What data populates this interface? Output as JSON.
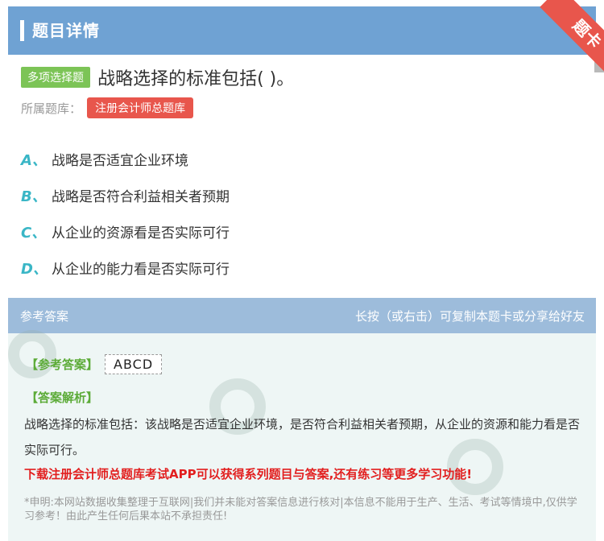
{
  "header": {
    "title": "题目详情"
  },
  "ribbon": {
    "label": "题卡"
  },
  "question": {
    "type_badge": "多项选择题",
    "text": "战略选择的标准包括( )。",
    "bank_label": "所属题库：",
    "bank_name": "注册会计师总题库"
  },
  "options": [
    {
      "letter": "A、",
      "text": "战略是否适宜企业环境"
    },
    {
      "letter": "B、",
      "text": "战略是否符合利益相关者预期"
    },
    {
      "letter": "C、",
      "text": "从企业的资源看是否实际可行"
    },
    {
      "letter": "D、",
      "text": "从企业的能力看是否实际可行"
    }
  ],
  "answer": {
    "section_title": "参考答案",
    "hint": "长按（或右击）可复制本题卡或分享给好友",
    "ref_label": "【参考答案】",
    "ref_value": "ABCD",
    "analysis_label": "【答案解析】",
    "analysis_text": "战略选择的标准包括：该战略是否适宜企业环境，是否符合利益相关者预期，从企业的资源和能力看是否实际可行。",
    "promo": "下载注册会计师总题库考试APP可以获得系列题目与答案,还有练习等更多学习功能!",
    "disclaimer": "*申明:本网站数据收集整理于互联网|我们并未能对答案信息进行核对|本信息不能用于生产、生活、考试等情境中,仅供学习参考！由此产生任何后果本站不承担责任!"
  },
  "colors": {
    "header_bg": "#6fa2d3",
    "type_badge": "#7cc456",
    "bank_tag": "#e8564c",
    "option_letter": "#3ab6c6",
    "answer_label": "#5cab38",
    "promo": "#e21f1f"
  }
}
